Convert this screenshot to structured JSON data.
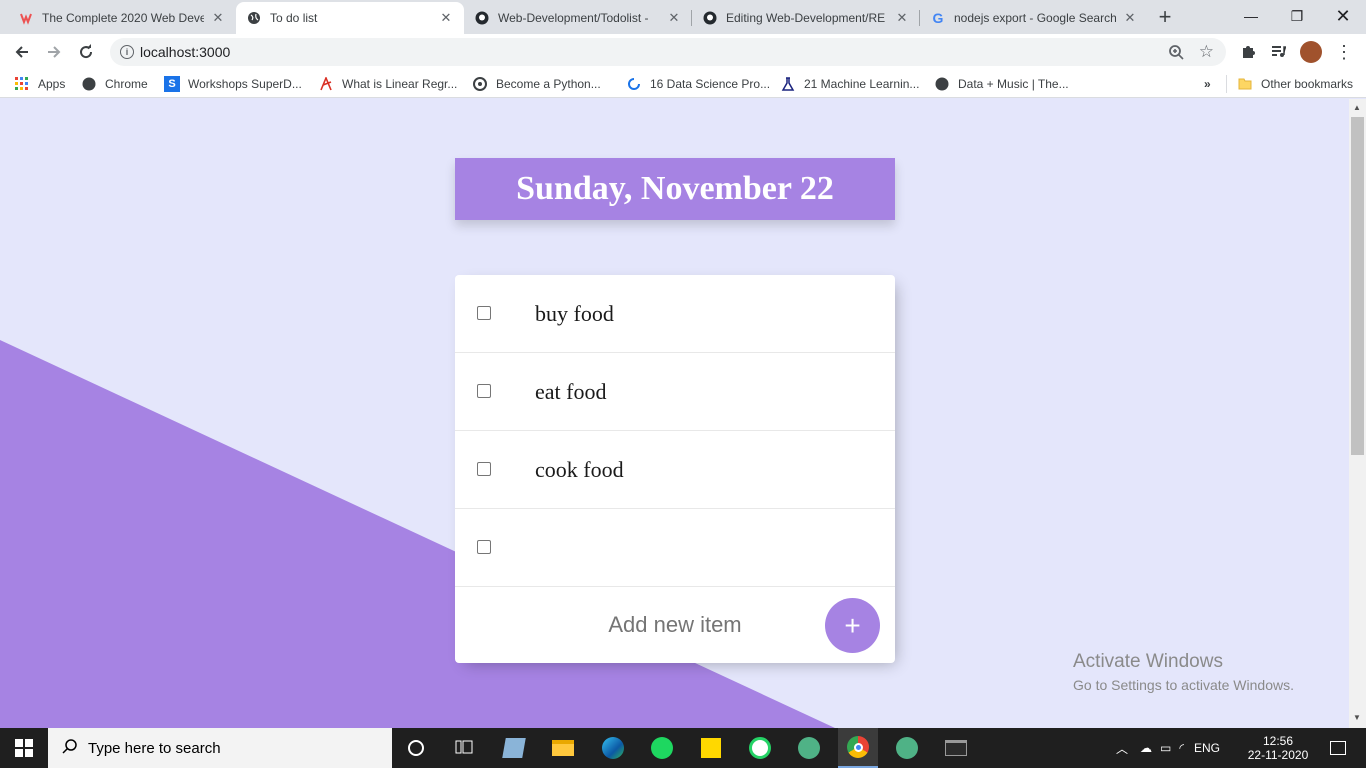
{
  "browser": {
    "tabs": [
      {
        "title": "The Complete 2020 Web Deve",
        "icon": "udemy-icon"
      },
      {
        "title": "To do list",
        "icon": "globe-icon"
      },
      {
        "title": "Web-Development/Todolist - ",
        "icon": "github-icon"
      },
      {
        "title": "Editing Web-Development/RE",
        "icon": "github-icon"
      },
      {
        "title": "nodejs export - Google Search",
        "icon": "google-icon"
      }
    ],
    "active_tab": 1,
    "url": "localhost:3000",
    "bookmarks": [
      {
        "label": "Apps",
        "icon": "apps-grid-icon"
      },
      {
        "label": "Chrome",
        "icon": "globe-icon"
      },
      {
        "label": "Workshops SuperD...",
        "icon": "s-logo-icon"
      },
      {
        "label": "What is Linear Regr...",
        "icon": "arrow-logo-icon"
      },
      {
        "label": "Become a Python...",
        "icon": "python-logo-icon"
      },
      {
        "label": "16 Data Science Pro...",
        "icon": "spiral-logo-icon"
      },
      {
        "label": "21 Machine Learnin...",
        "icon": "flask-icon"
      },
      {
        "label": "Data + Music | The...",
        "icon": "globe-icon"
      }
    ],
    "other_bookmarks": "Other bookmarks"
  },
  "page": {
    "heading": "Sunday, November 22",
    "items": [
      "buy food",
      "eat food",
      "cook food",
      ""
    ],
    "add_placeholder": "Add new item",
    "add_button": "+",
    "accent": "#a683e3",
    "background": "#e4e6fb"
  },
  "watermark": {
    "line1": "Activate Windows",
    "line2": "Go to Settings to activate Windows."
  },
  "taskbar": {
    "search_placeholder": "Type here to search",
    "lang": "ENG",
    "time": "12:56",
    "date": "22-11-2020"
  }
}
